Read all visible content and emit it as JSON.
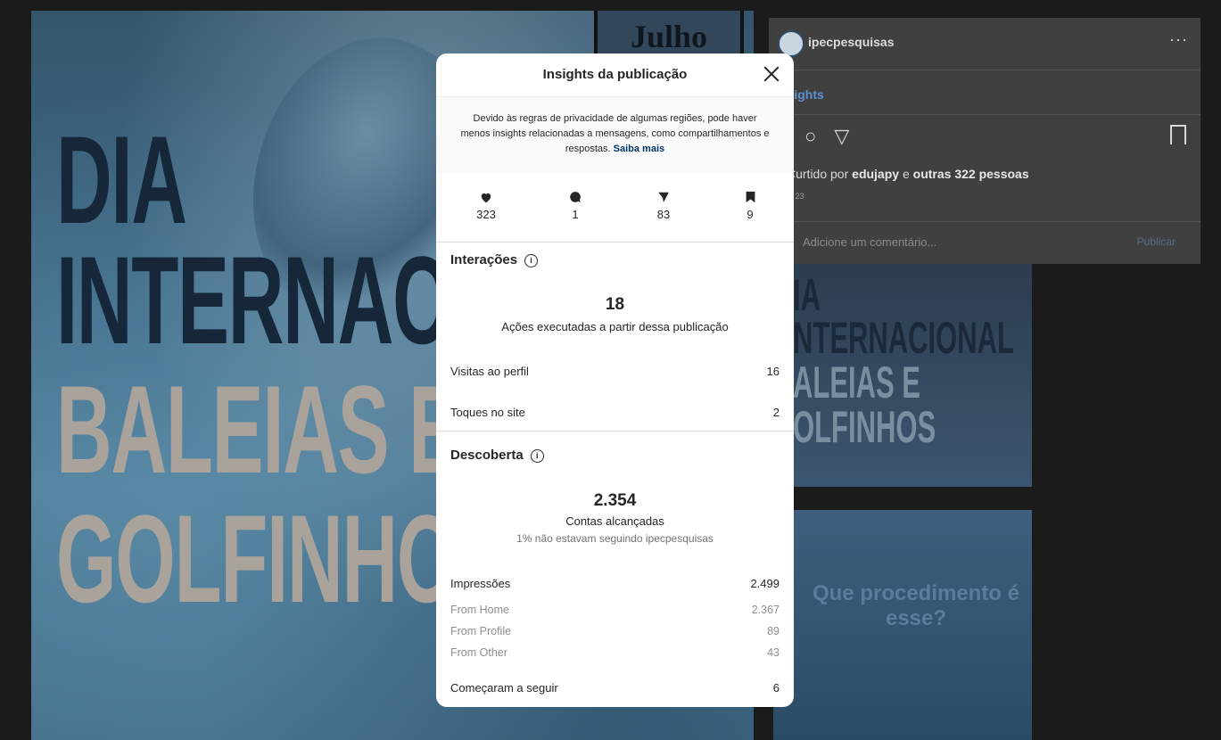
{
  "background": {
    "post": {
      "line1": "DIA",
      "line2": "INTERNAC",
      "line3": "BALEIAS E",
      "line4": "GOLFINHO",
      "month": "Julho"
    },
    "panel": {
      "username": "ipecpesquisas",
      "more": "···",
      "insights_link": "nsights",
      "liked_prefix": "Curtido por ",
      "liked_user": "edujapy",
      "liked_mid": " e ",
      "liked_others": "outras 322 pessoas",
      "date": "O 23",
      "comment_placeholder": "Adicione um comentário...",
      "publish": "Publicar"
    },
    "grid1": {
      "line1": "IA",
      "line2": "NTERNACIONAL",
      "line3": "ALEIAS E",
      "line4": "OLFINHOS"
    },
    "grid2": {
      "text": "Que procedimento é esse?"
    }
  },
  "modal": {
    "title": "Insights da publicação",
    "notice": "Devido às regras de privacidade de algumas regiões, pode haver menos insights relacionadas a mensagens, como compartilhamentos e respostas.",
    "notice_link": "Saiba mais",
    "stats": {
      "likes": "323",
      "comments": "1",
      "shares": "83",
      "saves": "9"
    },
    "interactions": {
      "title": "Interações",
      "total": "18",
      "caption": "Ações executadas a partir dessa publicação",
      "rows": [
        {
          "label": "Visitas ao perfil",
          "value": "16"
        },
        {
          "label": "Toques no site",
          "value": "2"
        }
      ]
    },
    "discovery": {
      "title": "Descoberta",
      "total": "2.354",
      "caption": "Contas alcançadas",
      "subcaption": "1% não estavam seguindo ipecpesquisas",
      "impressions_label": "Impressões",
      "impressions_value": "2.499",
      "breakdown": [
        {
          "label": "From Home",
          "value": "2.367"
        },
        {
          "label": "From Profile",
          "value": "89"
        },
        {
          "label": "From Other",
          "value": "43"
        }
      ],
      "follows_label": "Começaram a seguir",
      "follows_value": "6"
    }
  }
}
